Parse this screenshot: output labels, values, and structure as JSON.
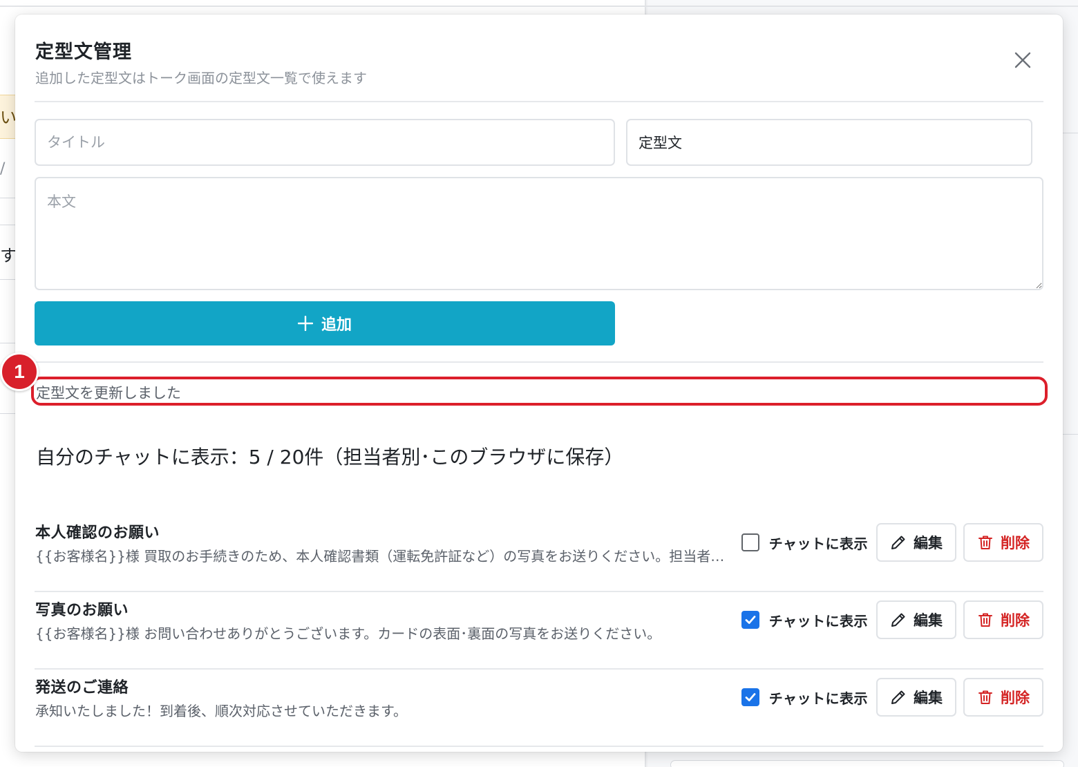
{
  "background": {
    "left_fragments": [
      "い。",
      "/ ",
      "す"
    ]
  },
  "modal": {
    "title": "定型文管理",
    "subtitle": "追加した定型文はトーク画面の定型文一覧で使えます",
    "close_icon": "close-icon",
    "form": {
      "title_placeholder": "タイトル",
      "category_value": "定型文",
      "body_placeholder": "本文",
      "add_label": "追加",
      "add_icon": "plus-icon"
    },
    "status_message": "定型文を更新しました",
    "annotation_number": "1",
    "list_heading": "自分のチャットに表示：5 / 20件（担当者別･このブラウザに保存）",
    "items": [
      {
        "title": "本人確認のお願い",
        "body": "{{お客様名}}様 買取のお手続きのため、本人確認書類（運転免許証など）の写真をお送りください。担当者が確認いたします。",
        "show_in_chat": false,
        "show_label": "チャットに表示",
        "edit_label": "編集",
        "delete_label": "削除"
      },
      {
        "title": "写真のお願い",
        "body": "{{お客様名}}様 お問い合わせありがとうございます。カードの表面･裏面の写真をお送りください。",
        "show_in_chat": true,
        "show_label": "チャットに表示",
        "edit_label": "編集",
        "delete_label": "削除"
      },
      {
        "title": "発送のご連絡",
        "body": "承知いたしました！到着後、順次対応させていただきます。",
        "show_in_chat": true,
        "show_label": "チャットに表示",
        "edit_label": "編集",
        "delete_label": "削除"
      }
    ]
  },
  "colors": {
    "primary_button": "#12a5c6",
    "checkbox_checked": "#1a73e8",
    "danger": "#d42424",
    "annotation": "#dc1f2b"
  }
}
